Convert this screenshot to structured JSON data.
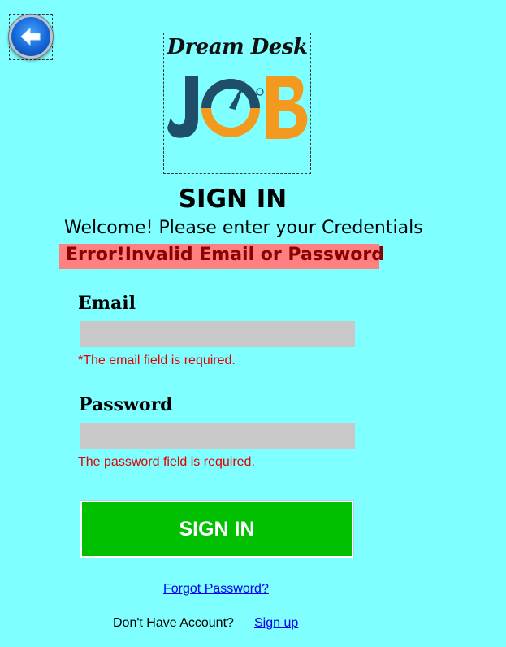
{
  "logo": {
    "tagline": "Dream Desk",
    "wordmark": "JOB",
    "colors": {
      "navy": "#1f4e6b",
      "orange": "#f39a1e"
    }
  },
  "back_button": {
    "icon": "arrow-left-icon"
  },
  "header": {
    "title": "SIGN IN",
    "subtitle": "Welcome! Please enter your Credentials"
  },
  "error_banner": {
    "text": "Error!Invalid Email or Password"
  },
  "form": {
    "email": {
      "label": "Email",
      "value": "",
      "error": "*The email field is required."
    },
    "password": {
      "label": "Password",
      "value": "",
      "error": "The password field is required."
    },
    "submit_label": "SIGN IN"
  },
  "footer": {
    "forgot_password": "Forgot Password?",
    "no_account": "Don't Have Account?",
    "signup": "Sign up"
  },
  "colors": {
    "background": "#7fffff",
    "error_banner": "#ff8080",
    "button": "#00c000",
    "validation": "#e00000"
  }
}
